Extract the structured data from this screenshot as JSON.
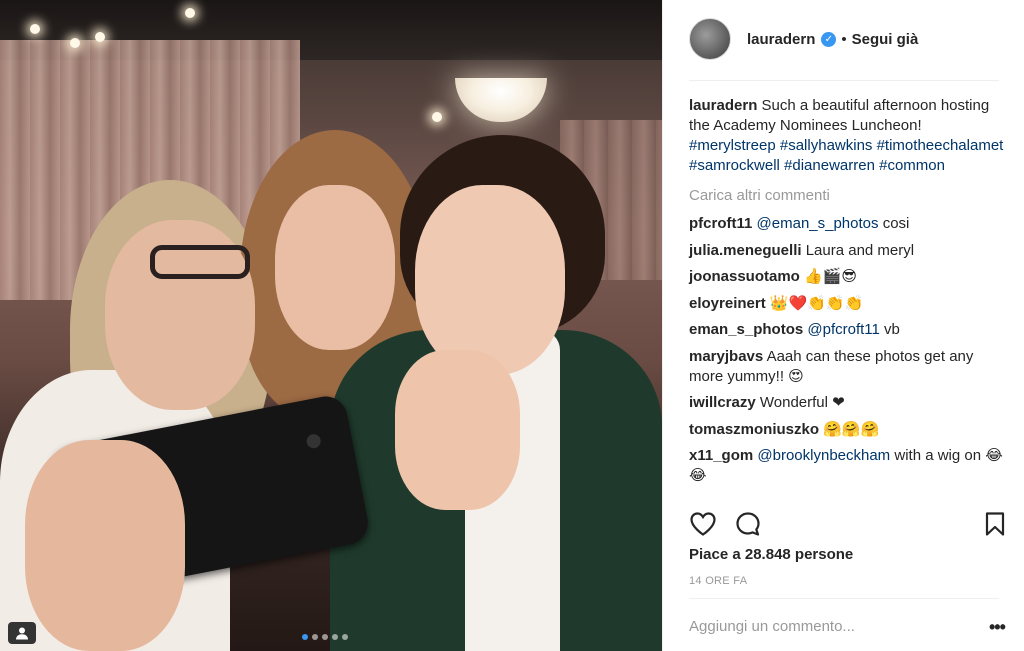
{
  "post": {
    "username": "lauradern",
    "follow_label": "Segui già",
    "separator": "•",
    "caption": {
      "user": "lauradern",
      "text": "Such a beautiful afternoon hosting the Academy Nominees Luncheon!",
      "hashtags": [
        "#merylstreep",
        "#sallyhawkins",
        "#timotheechalamet",
        "#samrockwell",
        "#dianewarren",
        "#common"
      ]
    },
    "load_more": "Carica altri commenti",
    "comments": [
      {
        "user": "pfcroft11",
        "mention": "@eman_s_photos",
        "text": "cosi"
      },
      {
        "user": "julia.meneguelli",
        "mention": "",
        "text": "Laura and meryl"
      },
      {
        "user": "joonassuotamo",
        "mention": "",
        "text": "👍🎬😎"
      },
      {
        "user": "eloyreinert",
        "mention": "",
        "text": "👑❤️👏👏👏"
      },
      {
        "user": "eman_s_photos",
        "mention": "@pfcroft11",
        "text": "vb"
      },
      {
        "user": "maryjbavs",
        "mention": "",
        "text": "Aaah can these photos get any more yummy!! 😍"
      },
      {
        "user": "iwillcrazy",
        "mention": "",
        "text": "Wonderful ❤"
      },
      {
        "user": "tomaszmoniuszko",
        "mention": "",
        "text": "🤗🤗🤗"
      },
      {
        "user": "x11_gom",
        "mention": "@brooklynbeckham",
        "text": "with a wig on 😂😂"
      }
    ],
    "likes": "Piace a 28.848 persone",
    "time": "14 ORE FA",
    "add_comment_placeholder": "Aggiungi un commento...",
    "more_label": "•••",
    "carousel": {
      "count": 5,
      "active": 0
    }
  },
  "colors": {
    "link": "#003569",
    "accent": "#3897f0",
    "muted": "#999999",
    "text": "#262626"
  },
  "icons": [
    "heart-icon",
    "comment-icon",
    "bookmark-icon",
    "user-tag-icon",
    "verified-badge-icon"
  ]
}
